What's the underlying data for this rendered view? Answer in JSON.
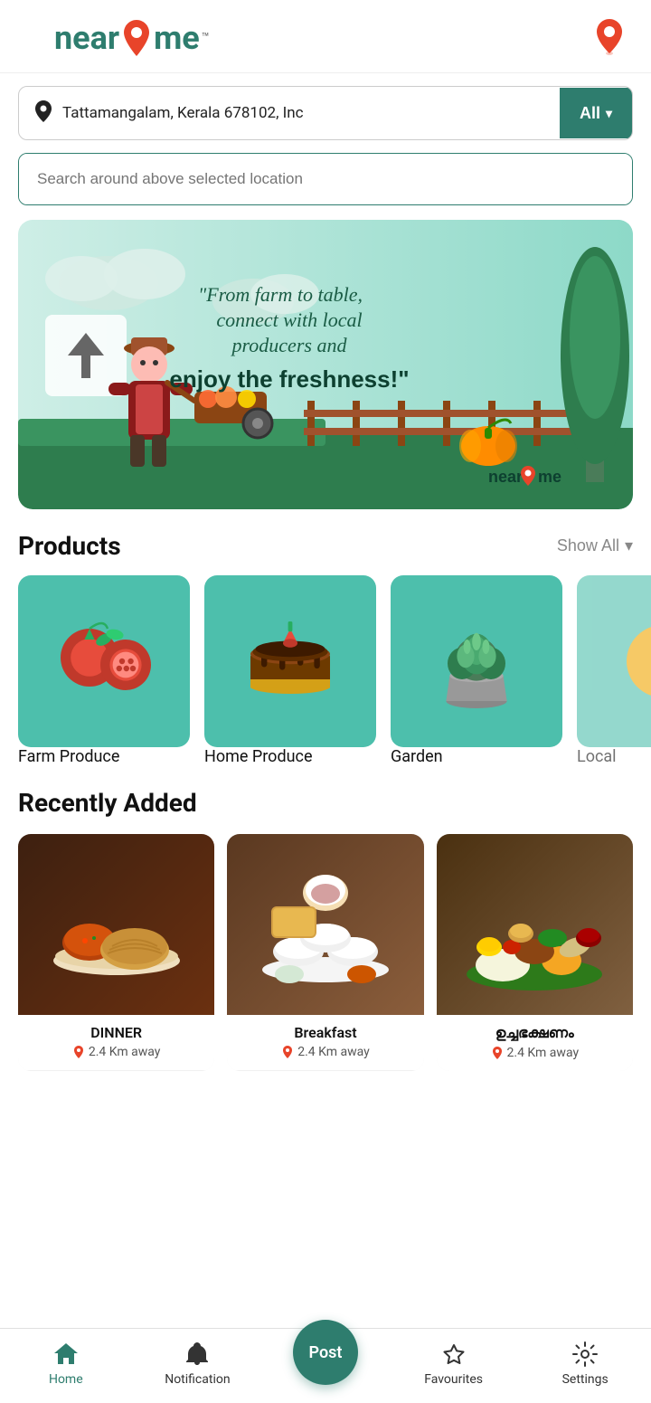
{
  "header": {
    "logo_near": "near",
    "logo_me": "me",
    "logo_tm": "™"
  },
  "location_bar": {
    "location_text": "Tattamangalam, Kerala 678102, Inc",
    "all_label": "All"
  },
  "search": {
    "placeholder": "Search around above selected location"
  },
  "banner": {
    "quote_line1": "\"From farm to table,",
    "quote_line2": "connect with local",
    "quote_line3": "producers and",
    "quote_highlight": "enjoy the freshness!\"",
    "brand": "near2me"
  },
  "products": {
    "section_title": "Products",
    "show_all_label": "Show All",
    "items": [
      {
        "label": "Farm Produce",
        "color": "#4dbfac"
      },
      {
        "label": "Home Produce",
        "color": "#4dbfac"
      },
      {
        "label": "Garden",
        "color": "#4dbfac"
      },
      {
        "label": "Local",
        "color": "#4dbfac"
      }
    ]
  },
  "recently_added": {
    "section_title": "Recently Added",
    "items": [
      {
        "title": "DINNER",
        "distance": "2.4 Km away",
        "bg": "#8B4513"
      },
      {
        "title": "Breakfast",
        "distance": "2.4 Km away",
        "bg": "#D2691E"
      },
      {
        "title": "ഉച്ചഭക്ഷണം",
        "distance": "2.4 Km away",
        "bg": "#DAA520"
      }
    ]
  },
  "bottom_nav": {
    "home_label": "Home",
    "notification_label": "Notification",
    "post_label": "Post",
    "favourites_label": "Favourites",
    "settings_label": "Settings"
  }
}
